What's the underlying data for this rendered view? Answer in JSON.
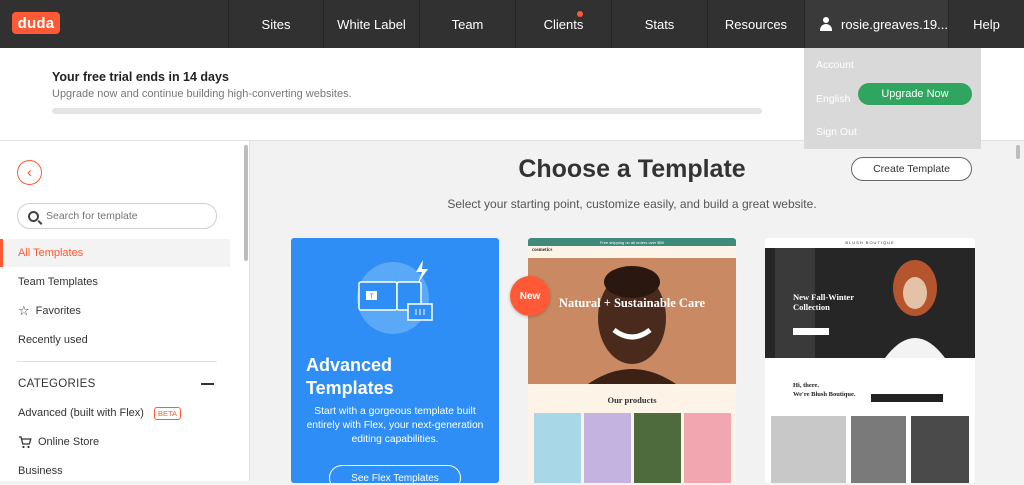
{
  "nav": {
    "logo": "duda",
    "items": [
      {
        "label": "Sites",
        "width": 96
      },
      {
        "label": "White Label",
        "width": 96
      },
      {
        "label": "Team",
        "width": 96
      },
      {
        "label": "Clients",
        "width": 96
      },
      {
        "label": "Stats",
        "width": 96
      },
      {
        "label": "Resources",
        "width": 96
      }
    ],
    "user": "rosie.greaves.19...",
    "help": "Help"
  },
  "banner": {
    "title": "Your free trial ends in 14 days",
    "subtitle": "Upgrade now and continue building high-converting websites."
  },
  "dropdown": {
    "account": "Account",
    "english": "English",
    "upgrade": "Upgrade Now",
    "signout": "Sign Out"
  },
  "sidebar": {
    "search_placeholder": "Search for template",
    "items": {
      "all": "All Templates",
      "team": "Team Templates",
      "favorites": "Favorites",
      "recent": "Recently used"
    },
    "categories_title": "CATEGORIES",
    "categories": {
      "advanced": "Advanced (built with Flex)",
      "beta": "BETA",
      "store": "Online Store",
      "business": "Business"
    }
  },
  "main": {
    "title": "Choose a Template",
    "subtitle": "Select your starting point, customize easily, and build a great website.",
    "create_button": "Create Template",
    "advanced_card": {
      "title_line1": "Advanced",
      "title_line2": "Templates",
      "description": "Start with a gorgeous template built entirely with Flex, your next-generation editing capabilities.",
      "button": "See Flex Templates"
    },
    "new_badge": "New",
    "template1": {
      "promo": "Free shipping on all orders over $50",
      "brand": "cosmetics",
      "hero": "Natural + Sustainable Care",
      "section": "Our products"
    },
    "template2": {
      "brand": "BLUSH BOUTIQUE",
      "hero_line1": "New Fall-Winter",
      "hero_line2": "Collection",
      "greeting_line1": "Hi, there.",
      "greeting_line2": "We're Blush Boutique."
    }
  },
  "colors": {
    "accent": "#ff5a35",
    "nav_bg": "#313131",
    "blue_card": "#2e8ef5",
    "upgrade_green": "#2fa55f"
  }
}
